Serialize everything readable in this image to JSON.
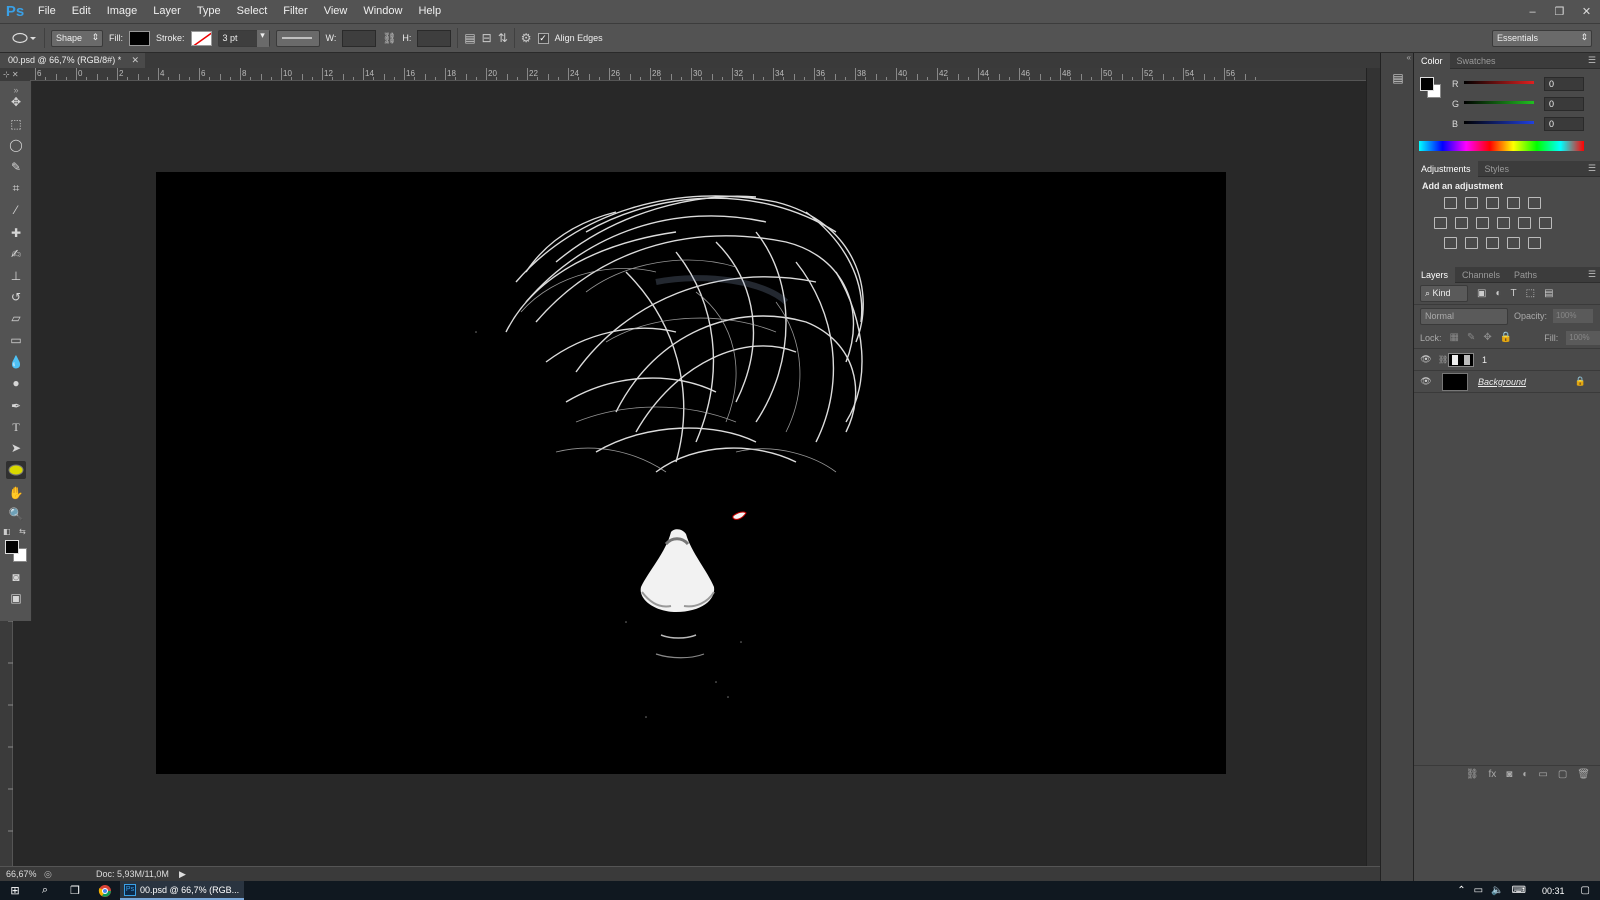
{
  "app": {
    "logo": "Ps"
  },
  "menu": [
    "File",
    "Edit",
    "Image",
    "Layer",
    "Type",
    "Select",
    "Filter",
    "View",
    "Window",
    "Help"
  ],
  "window_controls": {
    "minimize": "–",
    "restore": "❐",
    "close": "✕"
  },
  "options": {
    "shape_mode": "Shape",
    "fill_label": "Fill:",
    "stroke_label": "Stroke:",
    "stroke_size": "3 pt",
    "w_label": "W:",
    "h_label": "H:",
    "align_edges_label": "Align Edges",
    "align_edges_checked": true,
    "workspace": "Essentials"
  },
  "document": {
    "tab_title": "00.psd @ 66,7% (RGB/8#) *"
  },
  "ruler": {
    "top_labels": [
      "6",
      "0",
      "2",
      "4",
      "6",
      "8",
      "10",
      "12",
      "14",
      "16",
      "18",
      "20",
      "22",
      "24",
      "26",
      "28",
      "30",
      "32",
      "34",
      "36",
      "38",
      "40",
      "42",
      "44",
      "46",
      "48",
      "50",
      "52",
      "54",
      "56"
    ]
  },
  "status": {
    "zoom": "66,67%",
    "doc_info": "Doc: 5,93M/11,0M"
  },
  "color_panel": {
    "tabs": [
      "Color",
      "Swatches"
    ],
    "channels": [
      {
        "label": "R",
        "value": "0",
        "color": "#e02020"
      },
      {
        "label": "G",
        "value": "0",
        "color": "#20c020"
      },
      {
        "label": "B",
        "value": "0",
        "color": "#2040e0"
      }
    ]
  },
  "adjustments_panel": {
    "tabs": [
      "Adjustments",
      "Styles"
    ],
    "heading": "Add an adjustment"
  },
  "layers_panel": {
    "tabs": [
      "Layers",
      "Channels",
      "Paths"
    ],
    "filter": "Kind",
    "blend_mode": "Normal",
    "opacity_label": "Opacity:",
    "opacity_value": "100%",
    "lock_label": "Lock:",
    "fill_label": "Fill:",
    "fill_value": "100%",
    "layers": [
      {
        "name": "1",
        "visible": true
      },
      {
        "name": "Background",
        "visible": true,
        "locked": true
      }
    ]
  },
  "taskbar": {
    "active_app": "00.psd @ 66,7% (RGB...",
    "time": "00:31"
  }
}
